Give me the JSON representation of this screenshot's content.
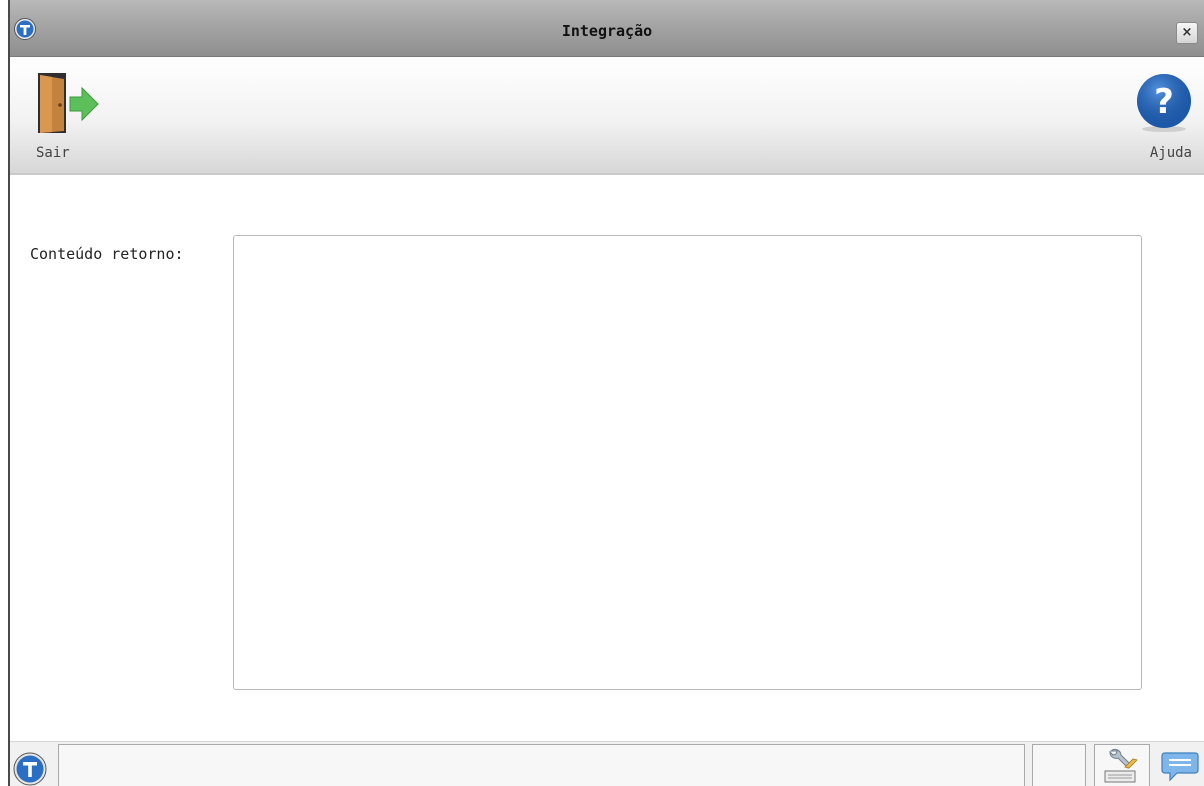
{
  "window": {
    "title": "Integração",
    "close_label": "×"
  },
  "toolbar": {
    "exit_label": "Sair",
    "help_label": "Ajuda"
  },
  "form": {
    "return_content_label": "Conteúdo retorno:",
    "return_content_value": ""
  },
  "statusbar": {
    "message": "",
    "info": ""
  },
  "icons": {
    "app_logo": "totvs-logo-icon",
    "exit": "exit-door-icon",
    "help": "help-question-icon",
    "tools": "tools-keyboard-icon",
    "chat": "chat-bubble-icon"
  },
  "colors": {
    "titlebar": "#a2a2a2",
    "help_blue": "#1d5fb2",
    "exit_arrow": "#5cc05a",
    "door": "#b8733a"
  }
}
